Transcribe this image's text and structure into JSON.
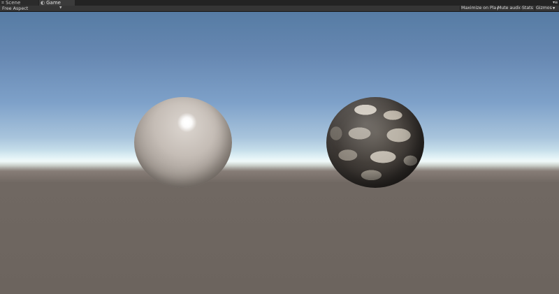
{
  "tabs": [
    {
      "label": "Scene",
      "icon": "scene-icon"
    },
    {
      "label": "Game",
      "icon": "game-icon",
      "active": true
    }
  ],
  "window_controls": {
    "label": "▾≡"
  },
  "toolbar": {
    "aspect_label": "Free Aspect",
    "maximize_on_play": "Maximize on Play",
    "mute_audio": "Mute audio",
    "stats": "Stats",
    "gizmos": "Gizmos"
  },
  "colors": {
    "sky_top": "#567ca4",
    "horizon": "#eaf7f7",
    "ground": "#6c645e",
    "editor_bg": "#353535"
  }
}
